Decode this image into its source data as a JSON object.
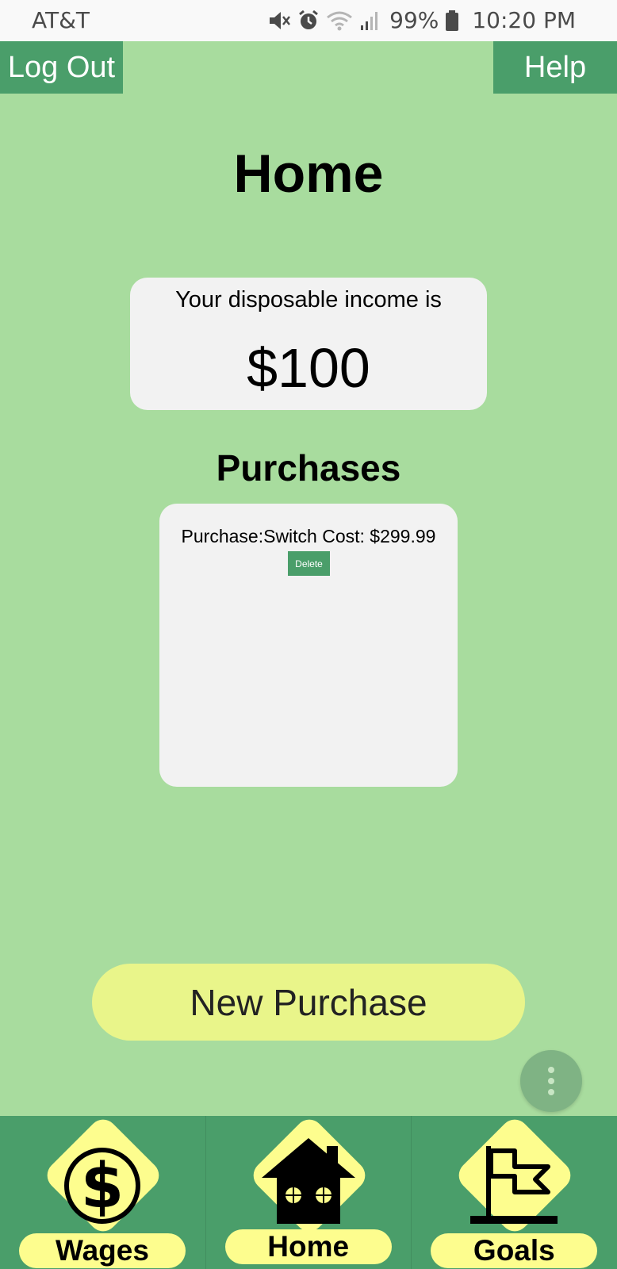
{
  "status_bar": {
    "carrier": "AT&T",
    "battery": "99%",
    "time": "10:20 PM",
    "icons": [
      "mute-icon",
      "alarm-icon",
      "wifi-icon",
      "signal-icon",
      "battery-icon"
    ]
  },
  "header": {
    "logout_label": "Log Out",
    "help_label": "Help"
  },
  "page": {
    "title": "Home"
  },
  "income": {
    "label": "Your disposable income is",
    "value": "$100"
  },
  "purchases": {
    "title": "Purchases",
    "items": [
      {
        "text": "Purchase:Switch Cost: $299.99",
        "delete_label": "Delete"
      }
    ]
  },
  "actions": {
    "new_purchase_label": "New Purchase",
    "more_icon": "more-vertical-icon"
  },
  "nav": {
    "items": [
      {
        "label": "Wages",
        "icon": "dollar-icon"
      },
      {
        "label": "Home",
        "icon": "house-icon"
      },
      {
        "label": "Goals",
        "icon": "flag-icon"
      }
    ]
  },
  "colors": {
    "background": "#a8dc9e",
    "accent_green": "#4a9e6a",
    "card": "#f2f2f2",
    "button_yellow": "#e9f58a",
    "nav_yellow": "#fdfd8e"
  }
}
